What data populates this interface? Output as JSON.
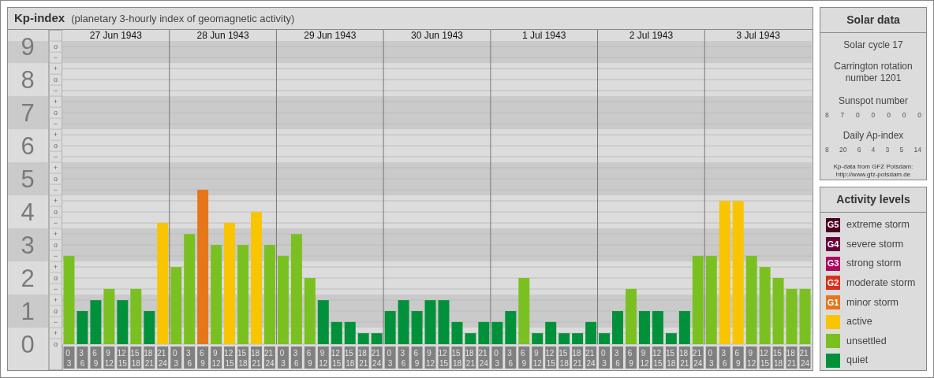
{
  "kp_panel": {
    "title": "Kp-index",
    "subtitle": "(planetary 3-hourly index of geomagnetic activity)",
    "date_headers": [
      "27 Jun 1943",
      "28 Jun 1943",
      "29 Jun 1943",
      "30 Jun 1943",
      "1 Jul 1943",
      "2 Jul 1943",
      "3 Jul 1943"
    ],
    "scale_marks": [
      "o",
      "−",
      "+",
      "o",
      "−",
      "+",
      "o",
      "−",
      "+",
      "o",
      "−",
      "+",
      "o",
      "−",
      "+",
      "o",
      "−",
      "+",
      "o",
      "−",
      "+",
      "o",
      "−",
      "+",
      "o",
      "−",
      "+",
      "o"
    ],
    "chart_data": {
      "type": "bar",
      "categories": [
        "0 3",
        "3 6",
        "6 9",
        "9 12",
        "12 15",
        "15 18",
        "18 21",
        "21 24",
        "0 3",
        "3 6",
        "6 9",
        "9 12",
        "12 15",
        "15 18",
        "18 21",
        "21 24",
        "0 3",
        "3 6",
        "6 9",
        "9 12",
        "12 15",
        "15 18",
        "18 21",
        "21 24",
        "0 3",
        "3 6",
        "6 9",
        "9 12",
        "12 15",
        "15 18",
        "18 21",
        "21 24",
        "0 3",
        "3 6",
        "6 9",
        "9 12",
        "12 15",
        "15 18",
        "18 21",
        "21 24",
        "0 3",
        "3 6",
        "6 9",
        "9 12",
        "12 15",
        "15 18",
        "18 21",
        "21 24",
        "0 3",
        "3 6",
        "6 9",
        "9 12",
        "12 15",
        "15 18",
        "18 21",
        "21 24"
      ],
      "series": [
        {
          "values": [
            2.67,
            1,
            1.33,
            1.67,
            1.33,
            1.67,
            1,
            3.67,
            2.33,
            3.33,
            4.67,
            3,
            3.67,
            3,
            4,
            3,
            2.67,
            3.33,
            2,
            1.33,
            0.67,
            0.67,
            0.33,
            0.33,
            1,
            1.33,
            1,
            1.33,
            1.33,
            0.67,
            0.33,
            0.67,
            0.67,
            1,
            2,
            0.33,
            0.67,
            0.33,
            0.33,
            0.67,
            0.33,
            1,
            1.67,
            1,
            1,
            0.33,
            1,
            2.67,
            2.67,
            4.33,
            4.33,
            2.67,
            2.33,
            2,
            1.67,
            1.67
          ]
        }
      ],
      "ylim": [
        0,
        9.17
      ],
      "grid": true,
      "bands": [
        {
          "axis": "y",
          "from": 0.5,
          "to": 1.5
        },
        {
          "axis": "y",
          "from": 2.5,
          "to": 3.5
        },
        {
          "axis": "y",
          "from": 4.5,
          "to": 5.5
        },
        {
          "axis": "y",
          "from": 6.5,
          "to": 7.5
        },
        {
          "axis": "y",
          "from": 8.5,
          "to": 9.17
        }
      ],
      "yticks": [
        0,
        1,
        2,
        3,
        4,
        5,
        6,
        7,
        8,
        9
      ]
    }
  },
  "solar_data": {
    "title": "Solar data",
    "solar_cycle": "Solar cycle 17",
    "carrington": "Carrington rotation number 1201",
    "sunspot_title": "Sunspot number",
    "sunspot_numbers": [
      "8",
      "7",
      "0",
      "0",
      "0",
      "0",
      "0"
    ],
    "ap_title": "Daily Ap-index",
    "ap_values": [
      "8",
      "20",
      "6",
      "4",
      "3",
      "5",
      "14"
    ],
    "source": "Kp-data from GFZ Potsdam:",
    "source_url": "http://www.gfz-potsdam.de"
  },
  "activity_levels": {
    "title": "Activity levels",
    "items": [
      {
        "code": "G5",
        "label": "extreme storm",
        "color": "#4c0024"
      },
      {
        "code": "G4",
        "label": "severe storm",
        "color": "#6a003c"
      },
      {
        "code": "G3",
        "label": "strong storm",
        "color": "#b0065f"
      },
      {
        "code": "G2",
        "label": "moderate storm",
        "color": "#d9301d"
      },
      {
        "code": "G1",
        "label": "minor storm",
        "color": "#e5771a"
      },
      {
        "label": "active",
        "color": "#f8c500"
      },
      {
        "label": "unsettled",
        "color": "#7bc021"
      },
      {
        "label": "quiet",
        "color": "#00913a"
      }
    ]
  }
}
